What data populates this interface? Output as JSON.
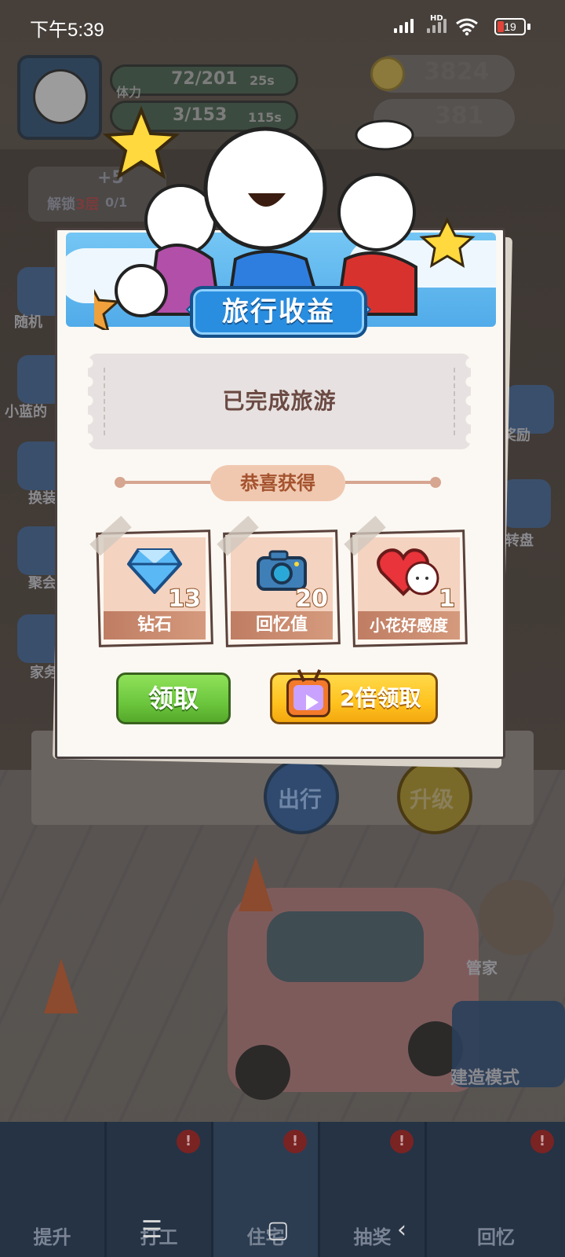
{
  "status_bar": {
    "time": "下午5:39",
    "network_label": "HD",
    "battery": "19"
  },
  "hud": {
    "stamina_label": "体力",
    "stamina_value": "72/201",
    "stamina_timer": "25s",
    "happiness_value": "3/153",
    "happiness_timer": "115s",
    "coins": "3824",
    "gems": "381",
    "unlock_prefix": "解锁",
    "unlock_floor": "3层",
    "unlock_progress": "0/1",
    "bonus": "+5"
  },
  "side_menu": {
    "random": "随机",
    "xiaolan": "小蓝的",
    "change": "换装",
    "gather": "聚会",
    "home": "家务",
    "reward": "奖励",
    "wheel": "大转盘",
    "butler": "管家",
    "build_mode": "建造模式"
  },
  "actions": {
    "travel": "出行",
    "upgrade": "升级"
  },
  "modal": {
    "title": "旅行收益",
    "status": "已完成旅游",
    "congrats": "恭喜获得",
    "rewards": [
      {
        "name": "钻石",
        "count": "13",
        "icon": "diamond-icon"
      },
      {
        "name": "回忆值",
        "count": "20",
        "icon": "camera-icon"
      },
      {
        "name": "小花好感度",
        "count": "1",
        "icon": "heart-cat-icon"
      }
    ],
    "claim_label": "领取",
    "double_claim_label": "2倍领取"
  },
  "bottom_nav": [
    {
      "label": "提升",
      "badge": ""
    },
    {
      "label": "打工",
      "badge": "!"
    },
    {
      "label": "住宅",
      "badge": "!"
    },
    {
      "label": "抽奖",
      "badge": "!"
    },
    {
      "label": "回忆",
      "badge": "!"
    }
  ],
  "colors": {
    "claim_green": "#6cc63d",
    "double_yellow": "#ffc21e",
    "title_blue": "#2a8ee0",
    "label_brown": "#6b4a43"
  }
}
